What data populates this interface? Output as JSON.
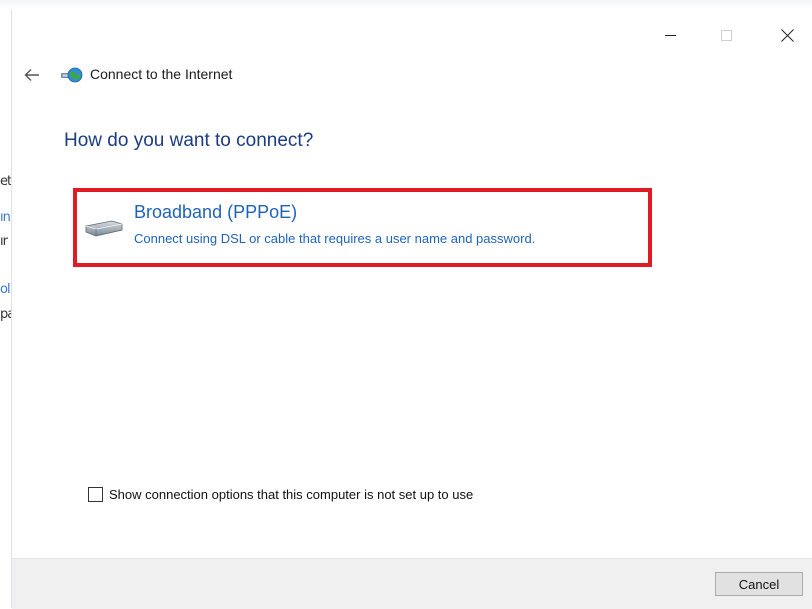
{
  "window": {
    "title": "Connect to the Internet",
    "icons": {
      "back": "back-arrow-icon",
      "app": "network-globe-icon",
      "minimize": "minimize-icon",
      "maximize": "maximize-icon",
      "close": "close-icon"
    }
  },
  "background_fragments": [
    "et",
    "ın",
    "ır",
    "ol",
    "pa"
  ],
  "page": {
    "heading": "How do you want to connect?"
  },
  "options": [
    {
      "title": "Broadband (PPPoE)",
      "description": "Connect using DSL or cable that requires a user name and password.",
      "icon": "broadband-modem-icon",
      "highlighted": true
    }
  ],
  "checkbox": {
    "label": "Show connection options that this computer is not set up to use",
    "checked": false
  },
  "footer": {
    "cancel_label": "Cancel"
  },
  "colors": {
    "heading": "#1d3b82",
    "link": "#1f63b8",
    "highlight": "#e01b24",
    "footer_bg": "#f0f0f0"
  }
}
